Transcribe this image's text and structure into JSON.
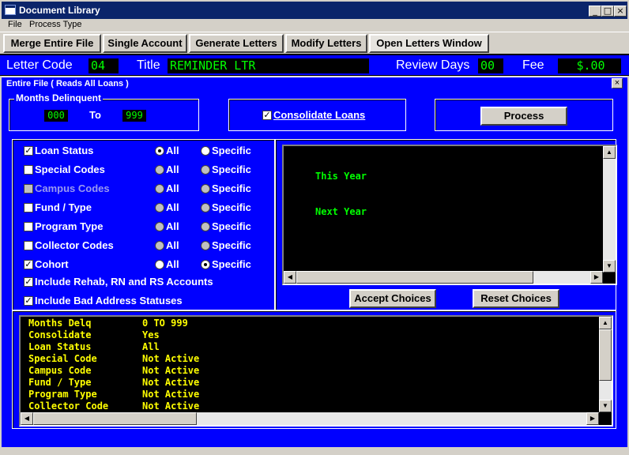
{
  "window": {
    "title": "Document Library",
    "min": "_",
    "max": "□",
    "close": "×"
  },
  "menu": [
    "File",
    "Process Type"
  ],
  "toolbar": {
    "merge": "Merge Entire File",
    "single": "Single Account",
    "generate": "Generate Letters",
    "modify": "Modify Letters",
    "open": "Open Letters Window"
  },
  "info": {
    "letter_code_label": "Letter Code",
    "letter_code": "04",
    "title_label": "Title",
    "title_value": "REMINDER LTR",
    "review_label": "Review Days",
    "review_value": "00",
    "fee_label": "Fee",
    "fee_value": "$.00"
  },
  "subwindow": {
    "title": "Entire File  ( Reads All Loans )",
    "close": "×"
  },
  "months": {
    "legend": "Months Delinquent",
    "from": "000",
    "to_label": "To",
    "to": "999"
  },
  "consolidate": {
    "label": "Consolidate Loans",
    "checked": true
  },
  "process_button": "Process",
  "criteria": [
    {
      "label": "Loan Status",
      "checked": true,
      "enabled": true,
      "all": "All",
      "specific": "Specific",
      "selected": "all"
    },
    {
      "label": "Special Codes",
      "checked": false,
      "enabled": true,
      "all": "All",
      "specific": "Specific",
      "selected": "none"
    },
    {
      "label": "Campus Codes",
      "checked": false,
      "enabled": false,
      "all": "All",
      "specific": "Specific",
      "selected": "none"
    },
    {
      "label": "Fund / Type",
      "checked": false,
      "enabled": true,
      "all": "All",
      "specific": "Specific",
      "selected": "none"
    },
    {
      "label": "Program Type",
      "checked": false,
      "enabled": true,
      "all": "All",
      "specific": "Specific",
      "selected": "none"
    },
    {
      "label": "Collector Codes",
      "checked": false,
      "enabled": true,
      "all": "All",
      "specific": "Specific",
      "selected": "none"
    },
    {
      "label": "Cohort",
      "checked": true,
      "enabled": true,
      "all": "All",
      "specific": "Specific",
      "selected": "specific"
    }
  ],
  "extras": [
    {
      "label": "Include Rehab, RN and RS Accounts",
      "checked": true
    },
    {
      "label": "Include Bad Address Statuses",
      "checked": true
    }
  ],
  "choices_list": [
    "This Year",
    "Next Year"
  ],
  "accept_button": "Accept Choices",
  "reset_button": "Reset Choices",
  "summary": [
    {
      "key": "Months Delq",
      "value": "0 TO 999"
    },
    {
      "key": "Consolidate",
      "value": "Yes"
    },
    {
      "key": "Loan Status",
      "value": "All"
    },
    {
      "key": "Special Code",
      "value": "Not Active"
    },
    {
      "key": "Campus Code",
      "value": "Not Active"
    },
    {
      "key": "Fund / Type",
      "value": "Not Active"
    },
    {
      "key": "Program Type",
      "value": "Not Active"
    },
    {
      "key": "Collector Code",
      "value": "Not Active"
    }
  ],
  "colors": {
    "panel": "#0000ff",
    "lcd_text": "#00ff00",
    "summary_text": "#ffff00",
    "titlebar": "#0a246a"
  }
}
